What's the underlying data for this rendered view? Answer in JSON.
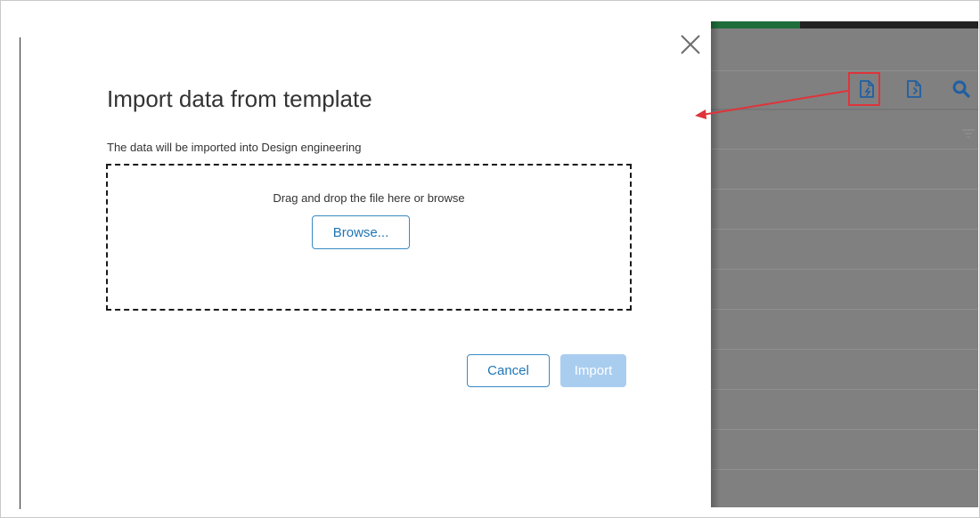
{
  "dialog": {
    "title": "Import data from template",
    "subtitle": "The data will be imported into Design engineering",
    "dropzone": {
      "text": "Drag and drop the file here or browse",
      "browse_label": "Browse..."
    },
    "buttons": {
      "cancel_label": "Cancel",
      "import_label": "Import",
      "import_disabled": true
    },
    "close_icon": "close-icon"
  },
  "background_app": {
    "toolbar_icons": [
      "import-template-icon",
      "export-template-icon",
      "search-icon"
    ],
    "highlighted_icon": "import-template-icon",
    "filter_icon": "filter-icon"
  },
  "colors": {
    "primary": "#1f76b5",
    "disabled_button": "#a9cdef",
    "highlight": "#e0333a",
    "overlay": "#808080",
    "toolbar_icon": "#1f5fa3"
  }
}
